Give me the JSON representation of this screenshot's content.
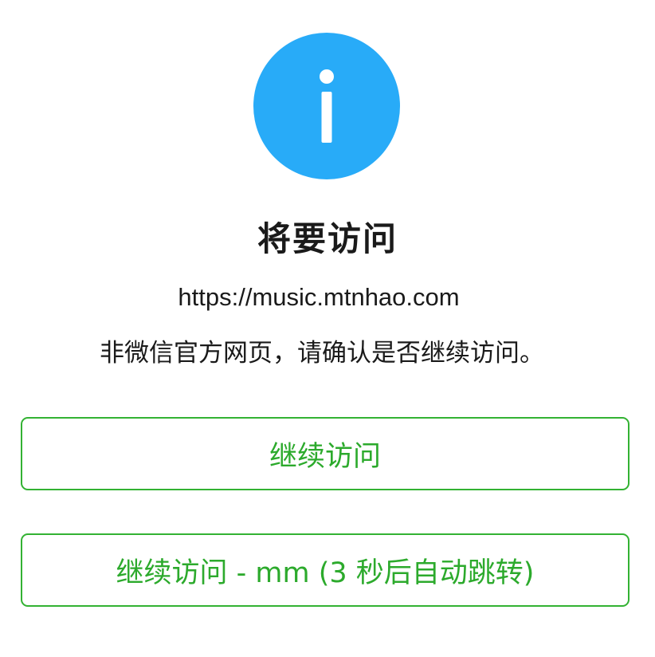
{
  "dialog": {
    "icon": "info-icon",
    "icon_color": "#28abf8",
    "title": "将要访问",
    "url": "https://music.mtnhao.com",
    "notice": "非微信官方网页，请确认是否继续访问。"
  },
  "buttons": {
    "continue_label": "继续访问",
    "auto_redirect_label": "继续访问 - mm (3 秒后自动跳转)",
    "border_color": "#33b233",
    "text_color": "#2caa2c"
  }
}
